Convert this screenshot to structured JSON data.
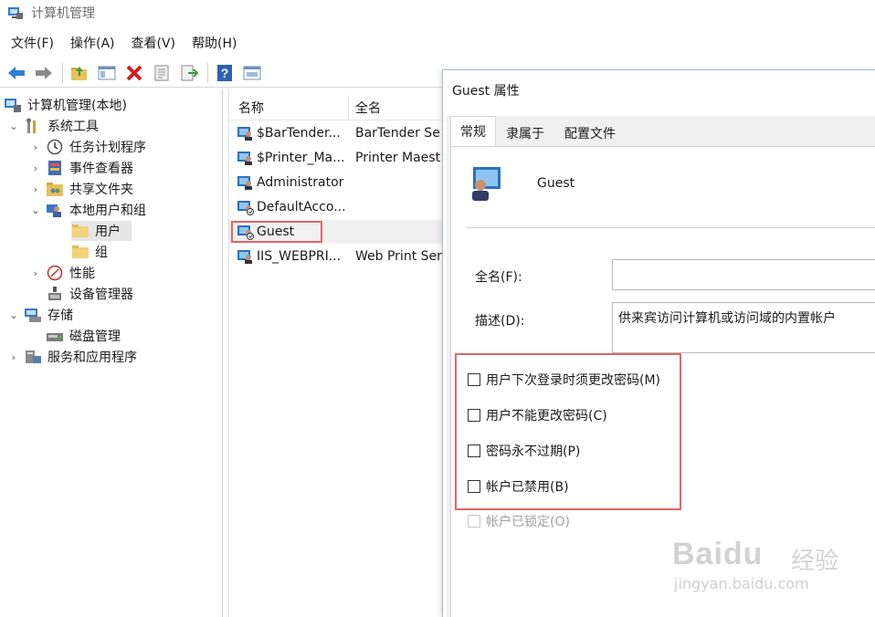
{
  "window": {
    "title": "计算机管理"
  },
  "menu": {
    "items": [
      "文件(F)",
      "操作(A)",
      "查看(V)",
      "帮助(H)"
    ]
  },
  "toolbar": {
    "icons": [
      "back-arrow-icon",
      "forward-arrow-icon",
      "up-folder-icon",
      "show-hide-tree-icon",
      "delete-icon",
      "properties-icon",
      "export-icon",
      "help-icon",
      "console-icon"
    ]
  },
  "tree": {
    "items": [
      {
        "label": "计算机管理(本地)",
        "icon": "computer-management-icon"
      },
      {
        "label": "系统工具",
        "icon": "tools-icon"
      },
      {
        "label": "任务计划程序",
        "icon": "clock-icon"
      },
      {
        "label": "事件查看器",
        "icon": "event-viewer-icon"
      },
      {
        "label": "共享文件夹",
        "icon": "shared-folder-icon"
      },
      {
        "label": "本地用户和组",
        "icon": "users-group-icon"
      },
      {
        "label": "用户",
        "icon": "folder-icon"
      },
      {
        "label": "组",
        "icon": "folder-icon"
      },
      {
        "label": "性能",
        "icon": "performance-icon"
      },
      {
        "label": "设备管理器",
        "icon": "device-manager-icon"
      },
      {
        "label": "存储",
        "icon": "storage-icon"
      },
      {
        "label": "磁盘管理",
        "icon": "disk-icon"
      },
      {
        "label": "服务和应用程序",
        "icon": "services-icon"
      }
    ]
  },
  "list": {
    "columns": [
      "名称",
      "全名"
    ],
    "rows": [
      {
        "name": "$BarTender...",
        "full": "BarTender Se"
      },
      {
        "name": "$Printer_Ma...",
        "full": "Printer Maest"
      },
      {
        "name": "Administrator",
        "full": ""
      },
      {
        "name": "DefaultAcco...",
        "full": ""
      },
      {
        "name": "Guest",
        "full": ""
      },
      {
        "name": "IIS_WEBPRI...",
        "full": "Web Print Ser"
      }
    ]
  },
  "dialog": {
    "title": "Guest 属性",
    "tabs": [
      "常规",
      "隶属于",
      "配置文件"
    ],
    "user_name": "Guest",
    "fullname_label": "全名(F):",
    "fullname_value": "",
    "description_label": "描述(D):",
    "description_value": "供来宾访问计算机或访问域的内置帐户",
    "checkboxes": [
      {
        "label": "用户下次登录时须更改密码(M)",
        "checked": false,
        "disabled": false
      },
      {
        "label": "用户不能更改密码(C)",
        "checked": false,
        "disabled": false
      },
      {
        "label": "密码永不过期(P)",
        "checked": false,
        "disabled": false
      },
      {
        "label": "帐户已禁用(B)",
        "checked": false,
        "disabled": false
      },
      {
        "label": "帐户已锁定(O)",
        "checked": false,
        "disabled": true
      }
    ]
  },
  "watermark": {
    "brand": "Baidu",
    "cn": "经验",
    "url": "jingyan.baidu.com"
  }
}
